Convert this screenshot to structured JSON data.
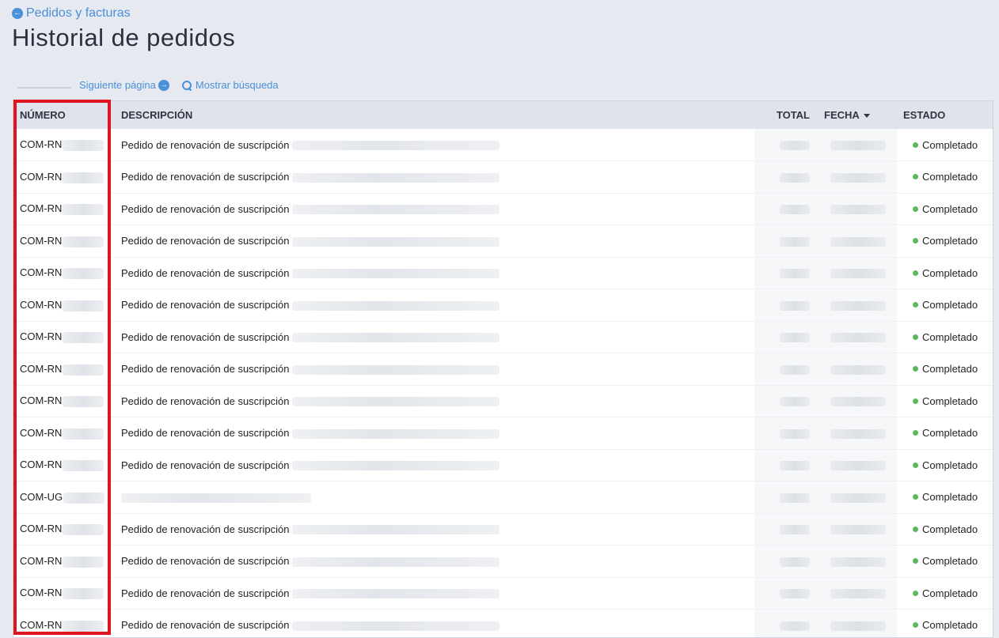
{
  "header": {
    "back_link_label": "Pedidos y facturas",
    "title": "Historial de pedidos"
  },
  "toolbar": {
    "next_label": "Siguiente página",
    "search_label": "Mostrar búsqueda"
  },
  "table": {
    "columns": {
      "numero": "NÚMERO",
      "descripcion": "DESCRIPCIÓN",
      "total": "TOTAL",
      "fecha": "FECHA",
      "estado": "ESTADO"
    },
    "rows": [
      {
        "numero": "COM-RN",
        "descripcion": "Pedido de renovación de suscripción",
        "estado": "Completado"
      },
      {
        "numero": "COM-RN",
        "descripcion": "Pedido de renovación de suscripción",
        "estado": "Completado"
      },
      {
        "numero": "COM-RN",
        "descripcion": "Pedido de renovación de suscripción",
        "estado": "Completado"
      },
      {
        "numero": "COM-RN",
        "descripcion": "Pedido de renovación de suscripción",
        "estado": "Completado"
      },
      {
        "numero": "COM-RN",
        "descripcion": "Pedido de renovación de suscripción",
        "estado": "Completado"
      },
      {
        "numero": "COM-RN",
        "descripcion": "Pedido de renovación de suscripción",
        "estado": "Completado"
      },
      {
        "numero": "COM-RN",
        "descripcion": "Pedido de renovación de suscripción",
        "estado": "Completado"
      },
      {
        "numero": "COM-RN",
        "descripcion": "Pedido de renovación de suscripción",
        "estado": "Completado"
      },
      {
        "numero": "COM-RN",
        "descripcion": "Pedido de renovación de suscripción",
        "estado": "Completado"
      },
      {
        "numero": "COM-RN",
        "descripcion": "Pedido de renovación de suscripción",
        "estado": "Completado"
      },
      {
        "numero": "COM-RN",
        "descripcion": "Pedido de renovación de suscripción",
        "estado": "Completado"
      },
      {
        "numero": "COM-UG",
        "descripcion": "",
        "estado": "Completado"
      },
      {
        "numero": "COM-RN",
        "descripcion": "Pedido de renovación de suscripción",
        "estado": "Completado"
      },
      {
        "numero": "COM-RN",
        "descripcion": "Pedido de renovación de suscripción",
        "estado": "Completado"
      },
      {
        "numero": "COM-RN",
        "descripcion": "Pedido de renovación de suscripción",
        "estado": "Completado"
      },
      {
        "numero": "COM-RN",
        "descripcion": "Pedido de renovación de suscripción",
        "estado": "Completado"
      }
    ]
  },
  "colors": {
    "accent": "#4a90d9",
    "status_completed": "#5cb85c",
    "highlight": "#e0141e"
  },
  "icons": {
    "back": "arrow-circle-left-icon",
    "next": "arrow-circle-right-icon",
    "search": "search-icon",
    "sort": "caret-down-icon"
  }
}
